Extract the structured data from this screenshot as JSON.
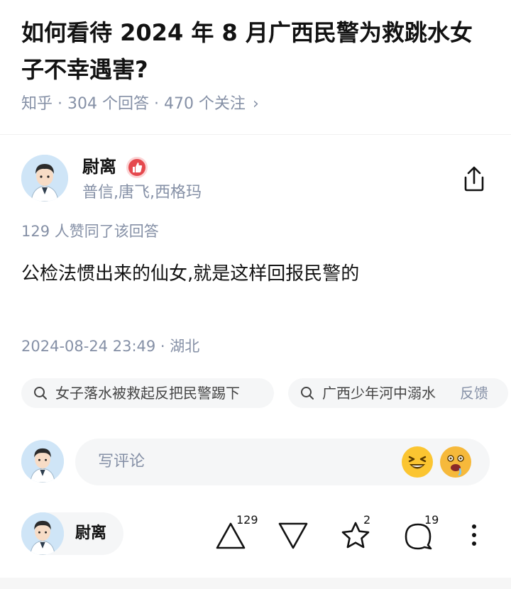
{
  "question": {
    "title": "如何看待 2024 年 8 月广西民警为救跳水女子不幸遇害?",
    "meta": "知乎 · 304 个回答 · 470 个关注",
    "chevron": "›"
  },
  "answer": {
    "author_name": "尉离",
    "author_tags": "普信,唐飞,西格玛",
    "vote_text": "129 人赞同了该回答",
    "content": "公检法惯出来的仙女,就是这样回报民警的",
    "time_location": "2024-08-24 23:49 · 湖北"
  },
  "related_searches": [
    {
      "label": "女子落水被救起反把民警踢下",
      "icon": "search-icon"
    },
    {
      "label": "广西少年河中溺水",
      "icon": "search-icon"
    }
  ],
  "feedback_label": "反馈",
  "comment": {
    "placeholder": "写评论",
    "emojis": [
      "grinning-squint-emoji",
      "drooling-emoji"
    ]
  },
  "bottom_bar": {
    "author_name": "尉离",
    "upvote_count": "129",
    "favorite_count": "2",
    "comment_count": "19",
    "icons": [
      "upvote-icon",
      "downvote-icon",
      "star-icon",
      "comment-bubble-icon",
      "more-icon"
    ]
  },
  "colors": {
    "primary_text": "#121212",
    "secondary_text": "#8590a6",
    "chip_background": "#f5f6f7",
    "badge_red": "#e5484d"
  }
}
